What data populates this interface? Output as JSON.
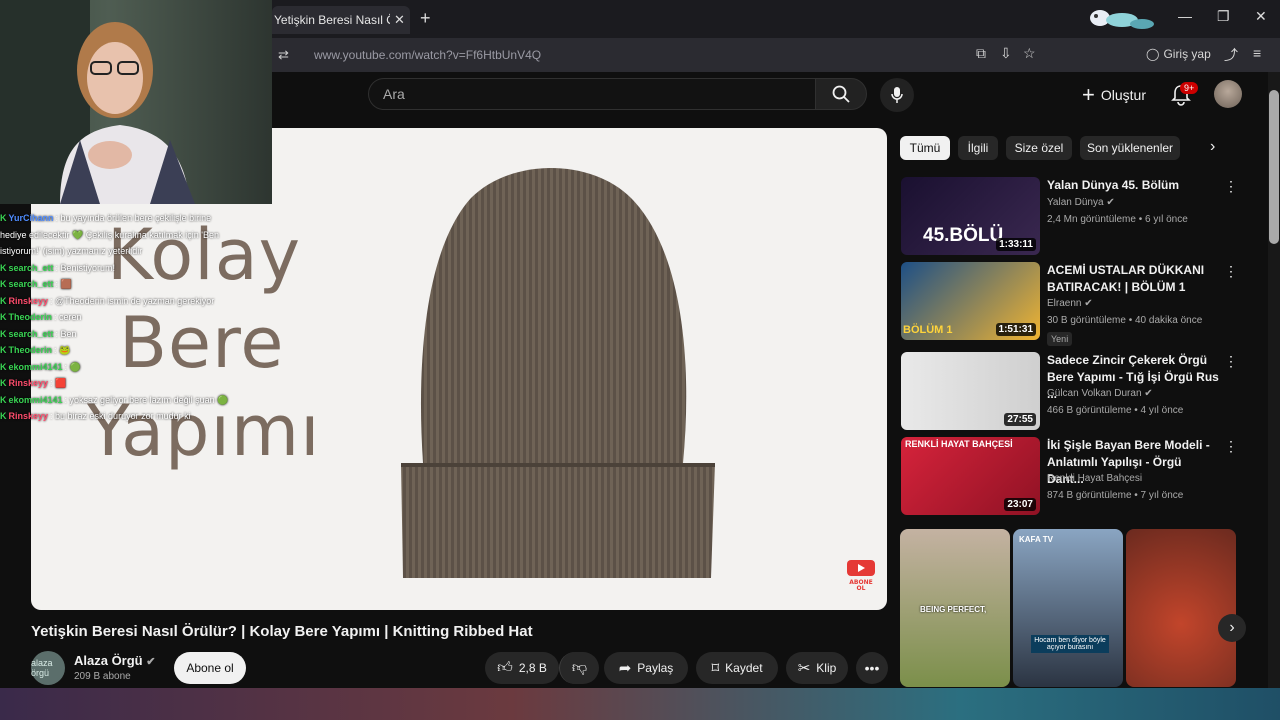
{
  "browser": {
    "tab_title": "Yetişkin Beresi Nasıl Örülür",
    "tab_close": "✕",
    "new_tab": "+",
    "url": "www.youtube.com/watch?v=Ff6HtbUnV4Q",
    "signin_label": "Giriş yap"
  },
  "header": {
    "search_placeholder": "Ara",
    "create_label": "Oluştur",
    "notif_count": "9+"
  },
  "video": {
    "overlay_lines": [
      "Kolay",
      "Bere",
      "Yapımı"
    ],
    "subscribe_badge": "ABONE OL",
    "title": "Yetişkin Beresi Nasıl Örülür? | Kolay Bere Yapımı | Knitting Ribbed Hat"
  },
  "channel": {
    "avatar_text": "alaza örgü",
    "name": "Alaza Örgü",
    "subs": "209 B abone",
    "subscribe_label": "Abone ol"
  },
  "actions": {
    "likes": "2,8 B",
    "share": "Paylaş",
    "save": "Kaydet",
    "clip": "Klip"
  },
  "chips": [
    "Tümü",
    "İlgili",
    "Size özel",
    "Son yüklenenler"
  ],
  "recommendations": [
    {
      "title": "Yalan Dünya 45. Bölüm",
      "channel": "Yalan Dünya",
      "meta": "2,4 Mn görüntüleme • 6 yıl önce",
      "duration": "1:33:11",
      "thumb_text": "45.BÖLÜ",
      "badge": ""
    },
    {
      "title": "ACEMİ USTALAR DÜKKANI BATIRACAK! | BÖLÜM 1",
      "channel": "Elraenn",
      "meta": "30 B görüntüleme • 40 dakika önce",
      "duration": "1:51:31",
      "thumb_text": "BÖLÜM 1",
      "badge": "Yeni"
    },
    {
      "title": "Sadece Zincir Çekerek Örgü Bere Yapımı - Tığ İşi Örgü Rus ...",
      "channel": "Gülcan Volkan Duran",
      "meta": "466 B görüntüleme • 4 yıl önce",
      "duration": "27:55",
      "thumb_text": "",
      "badge": ""
    },
    {
      "title": "İki Şişle Bayan Bere Modeli - Anlatımlı Yapılışı  -  Örgü Dant...",
      "channel": "Renkli Hayat Bahçesi",
      "meta": "874 B görüntüleme • 7 yıl önce",
      "duration": "23:07",
      "thumb_text": "RENKLİ HAYAT BAHÇESİ",
      "badge": ""
    }
  ],
  "shorts": [
    {
      "caption": "BEING PERFECT,"
    },
    {
      "caption": "Hocam ben diyor böyle açıyor burasını",
      "tag": "KAFA TV"
    },
    {
      "caption": ""
    }
  ],
  "chat": [
    {
      "user": "YurCihann",
      "user_color": "#4f8cff",
      "text": ": bu yayında örülen bere çekilişle birine hediye edilecektir 💚 Çekiliş kuralına katılmak için 'Ben istiyorum!' (isim) yazmanız yeterlidir"
    },
    {
      "user": "search_ett",
      "user_color": "#39d353",
      "text": ": Benistiyorum!"
    },
    {
      "user": "search_ett",
      "user_color": "#39d353",
      "text": ": 🟫"
    },
    {
      "user": "Rinskeyy",
      "user_color": "#ff4d6d",
      "text": ": @Theoderin ismin de yazman gerekiyor"
    },
    {
      "user": "Theoderin",
      "user_color": "#39d353",
      "text": ": ceren"
    },
    {
      "user": "search_ett",
      "user_color": "#39d353",
      "text": ": Ben"
    },
    {
      "user": "Theoderin",
      "user_color": "#39d353",
      "text": ": 🐸"
    },
    {
      "user": "ekommi4141",
      "user_color": "#39d353",
      "text": ": 🟢"
    },
    {
      "user": "Rinskeyy",
      "user_color": "#ff4d6d",
      "text": ": 🟥"
    },
    {
      "user": "ekommi4141",
      "user_color": "#39d353",
      "text": ": yoksaz geliyor bere lazım değil şuan 🟢"
    },
    {
      "user": "Rinskeyy",
      "user_color": "#ff4d6d",
      "text": ": bu biraz eski duruyor zor mudur ki"
    }
  ],
  "colors": {
    "accent_red": "#cc0000",
    "chip_bg": "#272727",
    "bg": "#0f0f0f"
  }
}
